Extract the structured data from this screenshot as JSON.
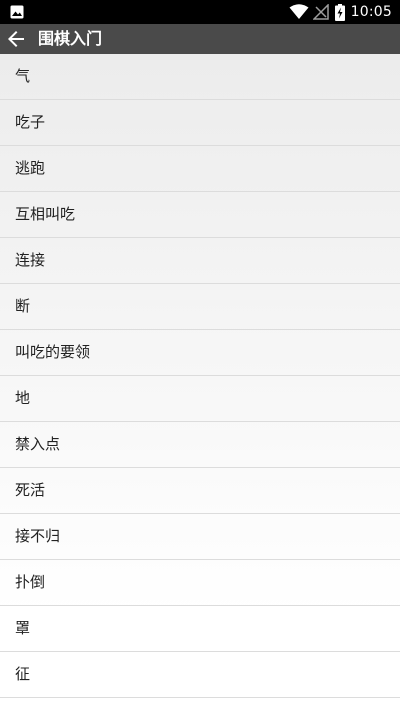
{
  "status_bar": {
    "time": "10:05",
    "icons": [
      "image-icon",
      "wifi-icon",
      "no-signal-icon",
      "battery-charging-icon"
    ]
  },
  "app_bar": {
    "title": "围棋入门",
    "back_icon": "arrow-left-icon"
  },
  "lessons": [
    {
      "label": "气"
    },
    {
      "label": "吃子"
    },
    {
      "label": "逃跑"
    },
    {
      "label": "互相叫吃"
    },
    {
      "label": "连接"
    },
    {
      "label": "断"
    },
    {
      "label": "叫吃的要领"
    },
    {
      "label": "地"
    },
    {
      "label": "禁入点"
    },
    {
      "label": "死活"
    },
    {
      "label": "接不归"
    },
    {
      "label": "扑倒"
    },
    {
      "label": "罩"
    },
    {
      "label": "征"
    }
  ],
  "colors": {
    "status_bar": "#000000",
    "app_bar": "#4a4a4a",
    "divider": "#dcdcdc",
    "text": "#222222"
  }
}
